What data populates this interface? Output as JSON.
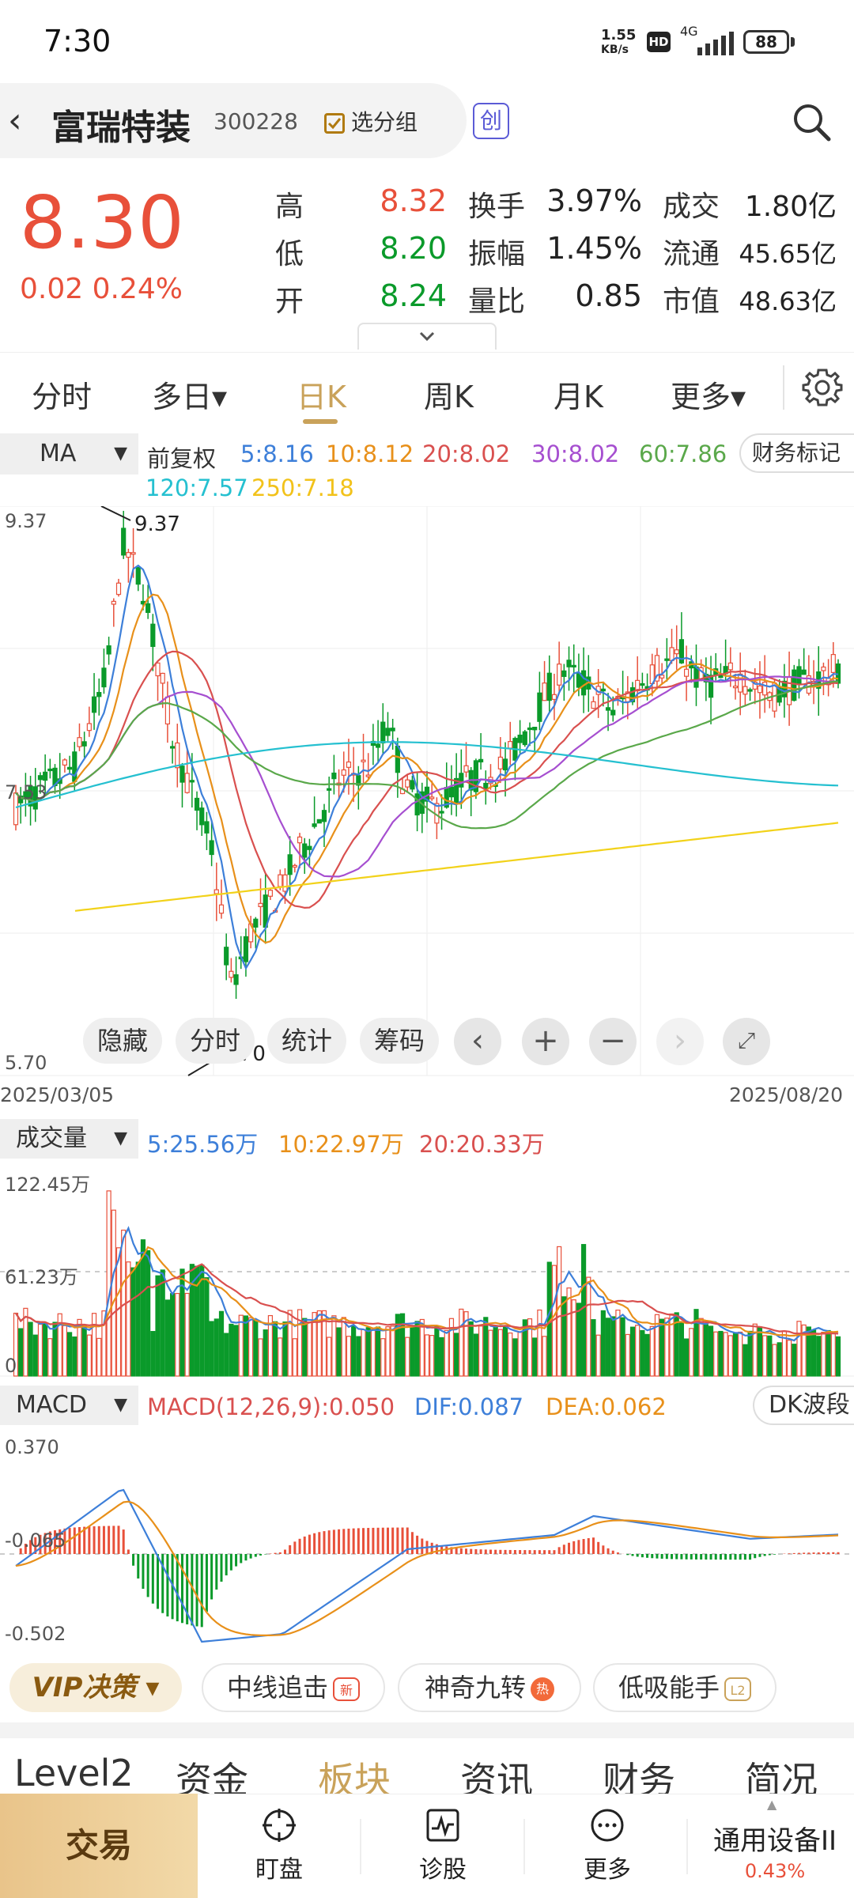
{
  "status": {
    "time": "7:30",
    "net_speed": "1.55",
    "net_unit": "KB/s",
    "hd": "HD",
    "network": "4G",
    "battery": "88"
  },
  "stock": {
    "name": "富瑞特装",
    "code": "300228",
    "group_label": "选分组",
    "board": "创"
  },
  "quote": {
    "price": "8.30",
    "change": "0.02",
    "change_pct": "0.24%",
    "high_label": "高",
    "high": "8.32",
    "low_label": "低",
    "low": "8.20",
    "open_label": "开",
    "open": "8.24",
    "turnover_label": "换手",
    "turnover": "3.97%",
    "amplitude_label": "振幅",
    "amplitude": "1.45%",
    "vol_ratio_label": "量比",
    "vol_ratio": "0.85",
    "amount_label": "成交",
    "amount": "1.80亿",
    "float_label": "流通",
    "float_cap": "45.65亿",
    "mcap_label": "市值",
    "mcap": "48.63亿",
    "expand_icon": "chevron-down-icon"
  },
  "tabs": [
    {
      "label": "分时"
    },
    {
      "label": "多日▾"
    },
    {
      "label": "日K"
    },
    {
      "label": "周K"
    },
    {
      "label": "月K"
    },
    {
      "label": "更多▾"
    }
  ],
  "ma": {
    "selector": "MA",
    "adjust": "前复权",
    "ma5": "5:8.16",
    "ma10": "10:8.12",
    "ma20": "20:8.02",
    "ma30": "30:8.02",
    "ma60": "60:7.86",
    "ma120": "120:7.57",
    "ma250": "250:7.18",
    "fin_mark": "财务标记",
    "colors": {
      "ma5": "#3d7fd9",
      "ma10": "#e8901a",
      "ma20": "#d9504f",
      "ma30": "#a64fd0",
      "ma60": "#5aa84a",
      "ma120": "#25c0d0",
      "ma250": "#f2d21a"
    }
  },
  "kchart": {
    "ymax_label": "9.37",
    "ymid_label": "7.53",
    "ymin_label": "5.70",
    "peak_label": "9.37",
    "trough_label": "5.70",
    "start_date": "2025/03/05",
    "end_date": "2025/08/20",
    "tools": {
      "hide": "隐藏",
      "timeshare": "分时",
      "stats": "统计",
      "chips": "筹码"
    }
  },
  "volume": {
    "selector": "成交量",
    "ma5": "5:25.56万",
    "ma10": "10:22.97万",
    "ma20": "20:20.33万",
    "ymax_label": "122.45万",
    "ymid_label": "61.23万",
    "ymin_label": "0"
  },
  "macd": {
    "selector": "MACD",
    "params": "MACD(12,26,9):0.050",
    "dif": "DIF:0.087",
    "dea": "DEA:0.062",
    "dk": "DK波段",
    "ymax_label": "0.370",
    "ymid_label": "-0.065",
    "ymin_label": "-0.502"
  },
  "features": {
    "vip": "VIP决策",
    "f1": "中线追击",
    "f1_badge": "新",
    "f2": "神奇九转",
    "f2_badge": "热",
    "f3": "低吸能手",
    "f3_badge": "L2"
  },
  "bottom_tabs": [
    {
      "label": "Level2"
    },
    {
      "label": "资金"
    },
    {
      "label": "板块"
    },
    {
      "label": "资讯"
    },
    {
      "label": "财务"
    },
    {
      "label": "简况"
    }
  ],
  "nav": {
    "trade": "交易",
    "watch": "盯盘",
    "diagnose": "诊股",
    "more": "更多",
    "sector": "通用设备II",
    "sector_pct": "0.43%"
  }
}
